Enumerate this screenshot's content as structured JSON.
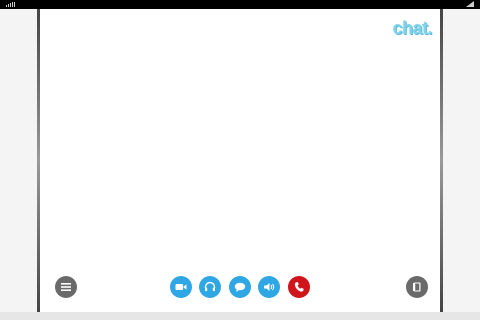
{
  "logo": "chat.",
  "icons": {
    "menu": "menu-icon",
    "video": "video-camera-icon",
    "audio": "headset-icon",
    "chat": "chat-bubble-icon",
    "volume": "speaker-icon",
    "hangup": "phone-hangup-icon",
    "book": "book-icon"
  },
  "colors": {
    "accent": "#2fa7e4",
    "hangup": "#d0141b",
    "neutral": "#6a6a6a",
    "logo": "#7fd3ec"
  }
}
